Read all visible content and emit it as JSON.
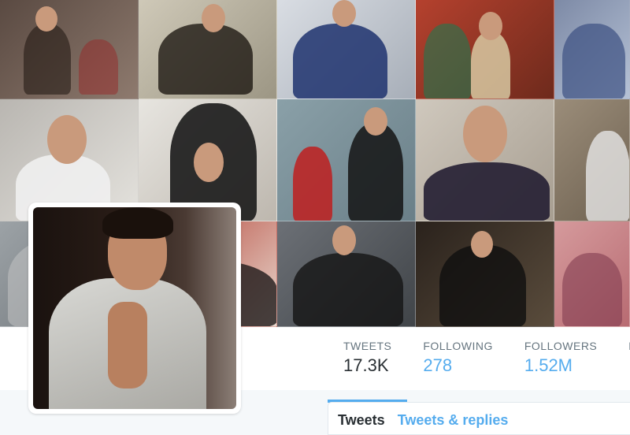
{
  "header": {
    "collage_description_tiles": 14
  },
  "stats": [
    {
      "label": "TWEETS",
      "value": "17.3K",
      "active": true
    },
    {
      "label": "FOLLOWING",
      "value": "278",
      "active": false
    },
    {
      "label": "FOLLOWERS",
      "value": "1.52M",
      "active": false
    },
    {
      "label": "L",
      "value": "",
      "active": false
    }
  ],
  "timeline": {
    "heading": "Tweets",
    "tab": "Tweets & replies"
  },
  "colors": {
    "accent": "#55acee",
    "text": "#292f33",
    "muted": "#66757f"
  }
}
